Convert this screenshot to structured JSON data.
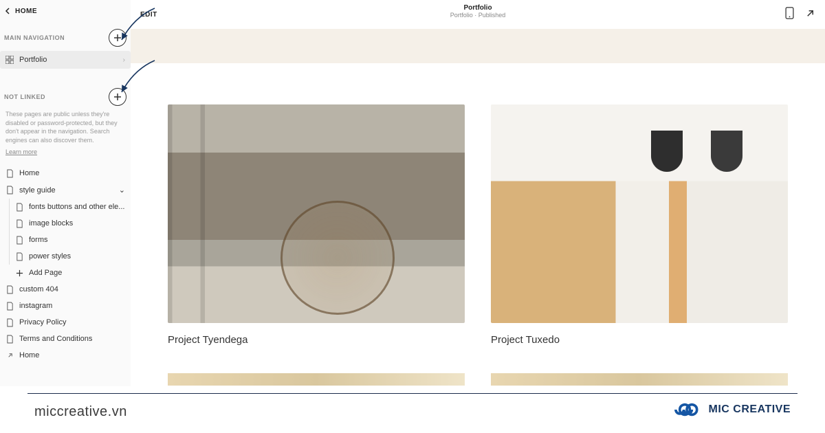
{
  "sidebar": {
    "home_link": "HOME",
    "main_nav_label": "MAIN NAVIGATION",
    "nav_item_portfolio": "Portfolio",
    "not_linked_label": "NOT LINKED",
    "not_linked_desc": "These pages are public unless they're disabled or password-protected, but they don't appear in the navigation. Search engines can also discover them.",
    "learn_more": "Learn more",
    "pages": {
      "home": "Home",
      "style_guide": "style guide",
      "fonts": "fonts buttons and other ele...",
      "image_blocks": "image blocks",
      "forms": "forms",
      "power_styles": "power styles",
      "add_page": "Add Page",
      "custom_404": "custom 404",
      "instagram": "instagram",
      "privacy": "Privacy Policy",
      "terms": "Terms and Conditions",
      "home2": "Home"
    }
  },
  "topbar": {
    "edit": "EDIT",
    "title": "Portfolio",
    "subtitle": "Portfolio · Published"
  },
  "content": {
    "card1_caption": "Project Tyendega",
    "card2_caption": "Project Tuxedo"
  },
  "footer": {
    "domain": "miccreative.vn",
    "brand": "MIC CREATIVE"
  }
}
